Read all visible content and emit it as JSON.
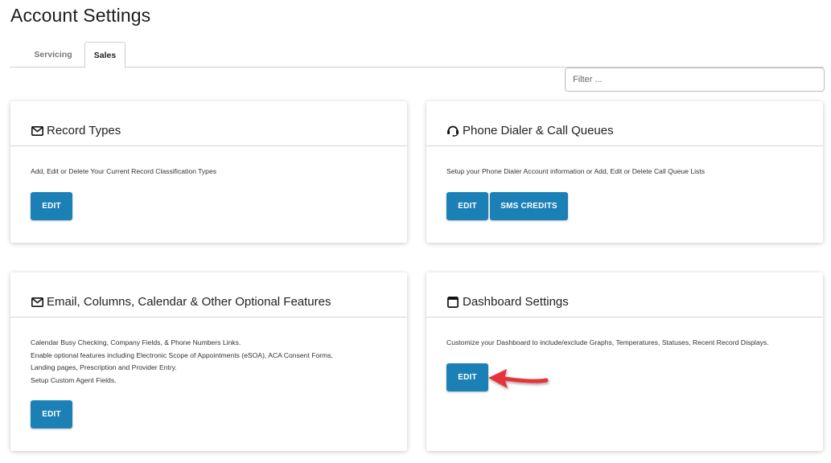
{
  "page": {
    "title": "Account Settings"
  },
  "tabs": [
    {
      "label": "Servicing",
      "active": false
    },
    {
      "label": "Sales",
      "active": true
    }
  ],
  "filter": {
    "placeholder": "Filter ...",
    "value": ""
  },
  "cards": [
    {
      "title": "Record Types",
      "icon": "envelope-icon",
      "description": [
        "Add, Edit or Delete Your Current Record Classification Types"
      ],
      "buttons": [
        "EDIT"
      ]
    },
    {
      "title": "Phone Dialer & Call Queues",
      "icon": "headset-icon",
      "description": [
        "Setup your Phone Dialer Account information or Add, Edit or Delete Call Queue Lists"
      ],
      "buttons": [
        "EDIT",
        "SMS CREDITS"
      ]
    },
    {
      "title": "Email, Columns, Calendar & Other Optional Features",
      "icon": "envelope-icon",
      "description": [
        "Calendar Busy Checking, Company Fields, & Phone Numbers Links.",
        "Enable optional features including Electronic Scope of Appointments (eSOA), ACA Consent Forms,",
        "Landing pages, Prescription and Provider Entry.",
        "Setup Custom Agent Fields."
      ],
      "buttons": [
        "EDIT"
      ]
    },
    {
      "title": "Dashboard Settings",
      "icon": "window-icon",
      "description": [
        "Customize your Dashboard to include/exclude Graphs, Temperatures, Statuses, Recent Record Displays."
      ],
      "buttons": [
        "EDIT"
      ]
    }
  ],
  "annotation": {
    "icon": "red-arrow-icon",
    "color": "#e8333a"
  },
  "colors": {
    "button": "#1b80b6",
    "button_text": "#ffffff"
  }
}
